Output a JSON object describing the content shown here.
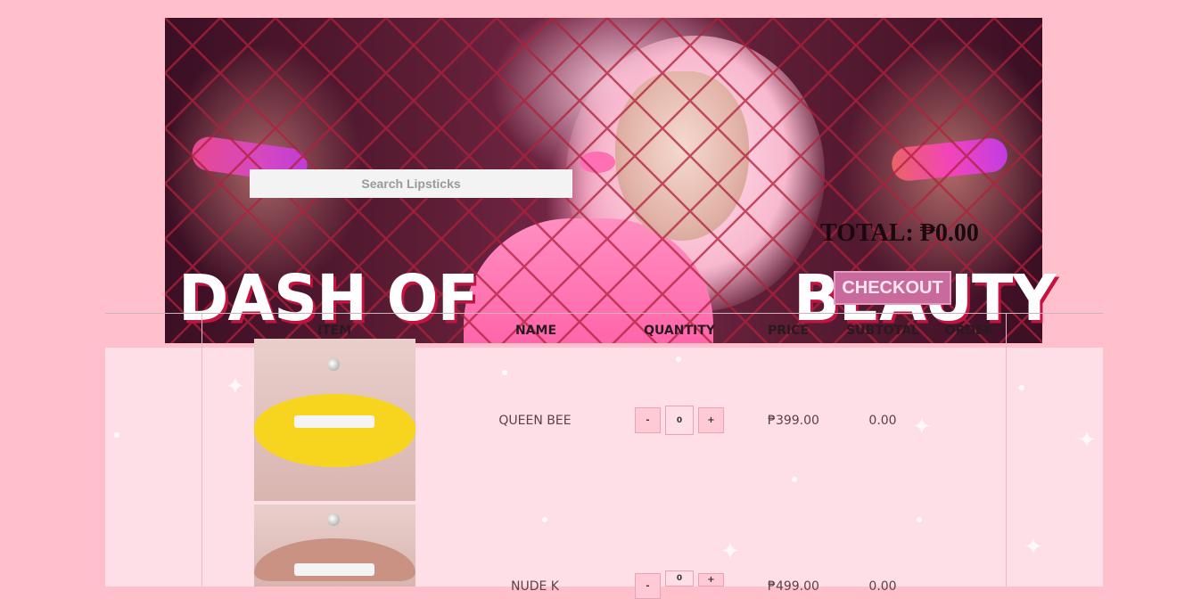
{
  "search": {
    "placeholder": "Search Lipsticks"
  },
  "brand": {
    "left": "DASH OF",
    "right": "BEAUTY"
  },
  "cart": {
    "total_label": "TOTAL: ₱0.00",
    "checkout_label": "CHECKOUT"
  },
  "table": {
    "headers": [
      "ITEM",
      "NAME",
      "QUANTITY",
      "PRICE",
      "SUBTOTAL",
      "ORDER"
    ],
    "rows": [
      {
        "name": "QUEEN BEE",
        "price": "₱399.00",
        "quantity": "0",
        "subtotal": "0.00",
        "minus": "-",
        "plus": "+",
        "lip_color": "#f7d51e"
      },
      {
        "name": "NUDE K",
        "price": "₱499.00",
        "quantity": "0",
        "subtotal": "0.00",
        "minus": "-",
        "plus": "+",
        "lip_color": "#c99283"
      }
    ]
  },
  "colors": {
    "page_bg": "#ffc0cb",
    "panel_bg": "#ffdfe7",
    "checkout_bg": "#c86a9c"
  }
}
